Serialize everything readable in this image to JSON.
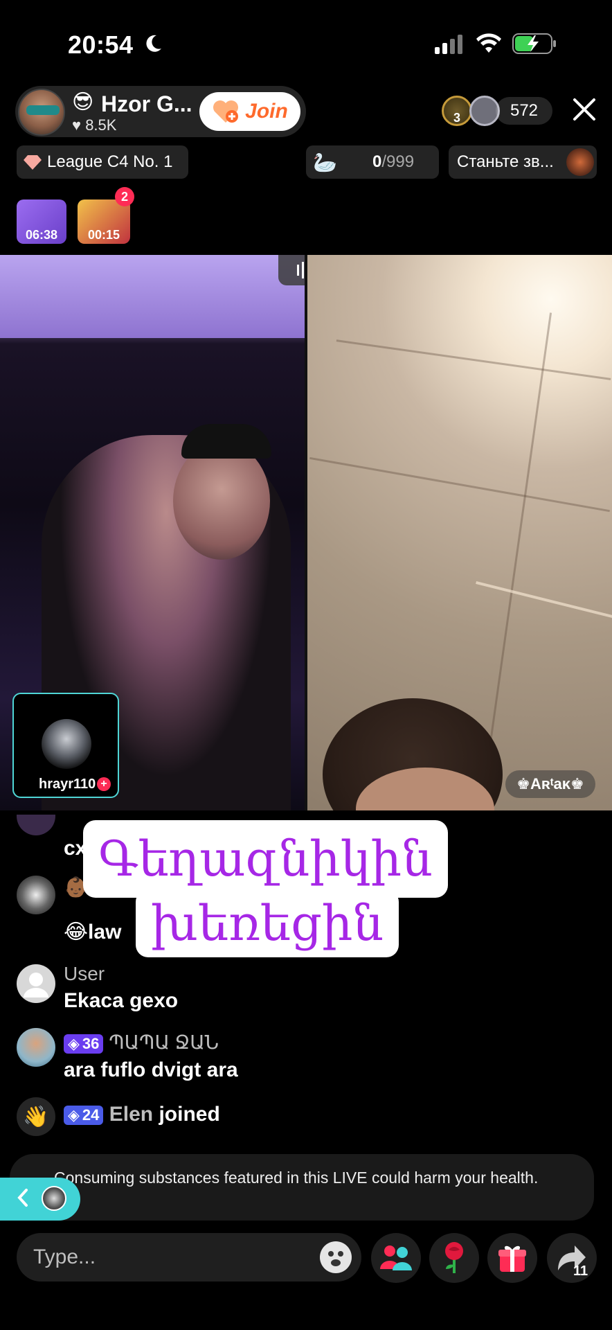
{
  "status_bar": {
    "time": "20:54"
  },
  "host": {
    "emoji": "😎",
    "name": "Hzor G...",
    "likes": "8.5K",
    "join_label": "Join"
  },
  "top_right": {
    "rank_badge": "3",
    "viewers": "572"
  },
  "league": {
    "label": "League C4 No. 1"
  },
  "goal": {
    "current": "0",
    "total": "/999"
  },
  "promo": {
    "label": "Станьте зв..."
  },
  "timers": {
    "gift_timer": "06:38",
    "chest_timer": "00:15",
    "chest_badge": "2"
  },
  "video": {
    "guest_cam_name": "hrayr110",
    "guest_tag": "♚Aʀᵗaκ♚"
  },
  "overlay": {
    "line1": "Գեղազնիկին",
    "line2": "խեռեցին"
  },
  "chat": [
    {
      "user": "",
      "message": "cx"
    },
    {
      "user": "👶🏾",
      "message": "😂law"
    },
    {
      "user": "User",
      "message": "Ekaca gexo"
    },
    {
      "badge": "36",
      "user": "ՊԱՊԱ ՋԱՆ",
      "message": "ara fuflo dvigt ara"
    },
    {
      "badge": "24",
      "user": "Elen",
      "message": "joined"
    }
  ],
  "warning": {
    "text": "Consuming substances featured in this LIVE could harm your health."
  },
  "bottom_bar": {
    "input_placeholder": "Type...",
    "share_count": "11"
  },
  "colors": {
    "accent_join": "#fe6a2c",
    "notification_red": "#fe2c55",
    "cyan": "#41d3d6",
    "overlay_purple": "#a627e6",
    "level_badge_purple": "#6a3df0",
    "level_badge_blue": "#4a5be8"
  },
  "icons": [
    "moon-icon",
    "signal-icon",
    "wifi-icon",
    "battery-charging-icon",
    "heart-icon",
    "join-heart-icon",
    "seat-icon",
    "close-icon",
    "gem-icon",
    "swan-icon",
    "sound-bars-icon",
    "chevron-left-icon",
    "emoji-icon",
    "multi-guest-icon",
    "rose-icon",
    "gift-icon",
    "share-icon"
  ]
}
